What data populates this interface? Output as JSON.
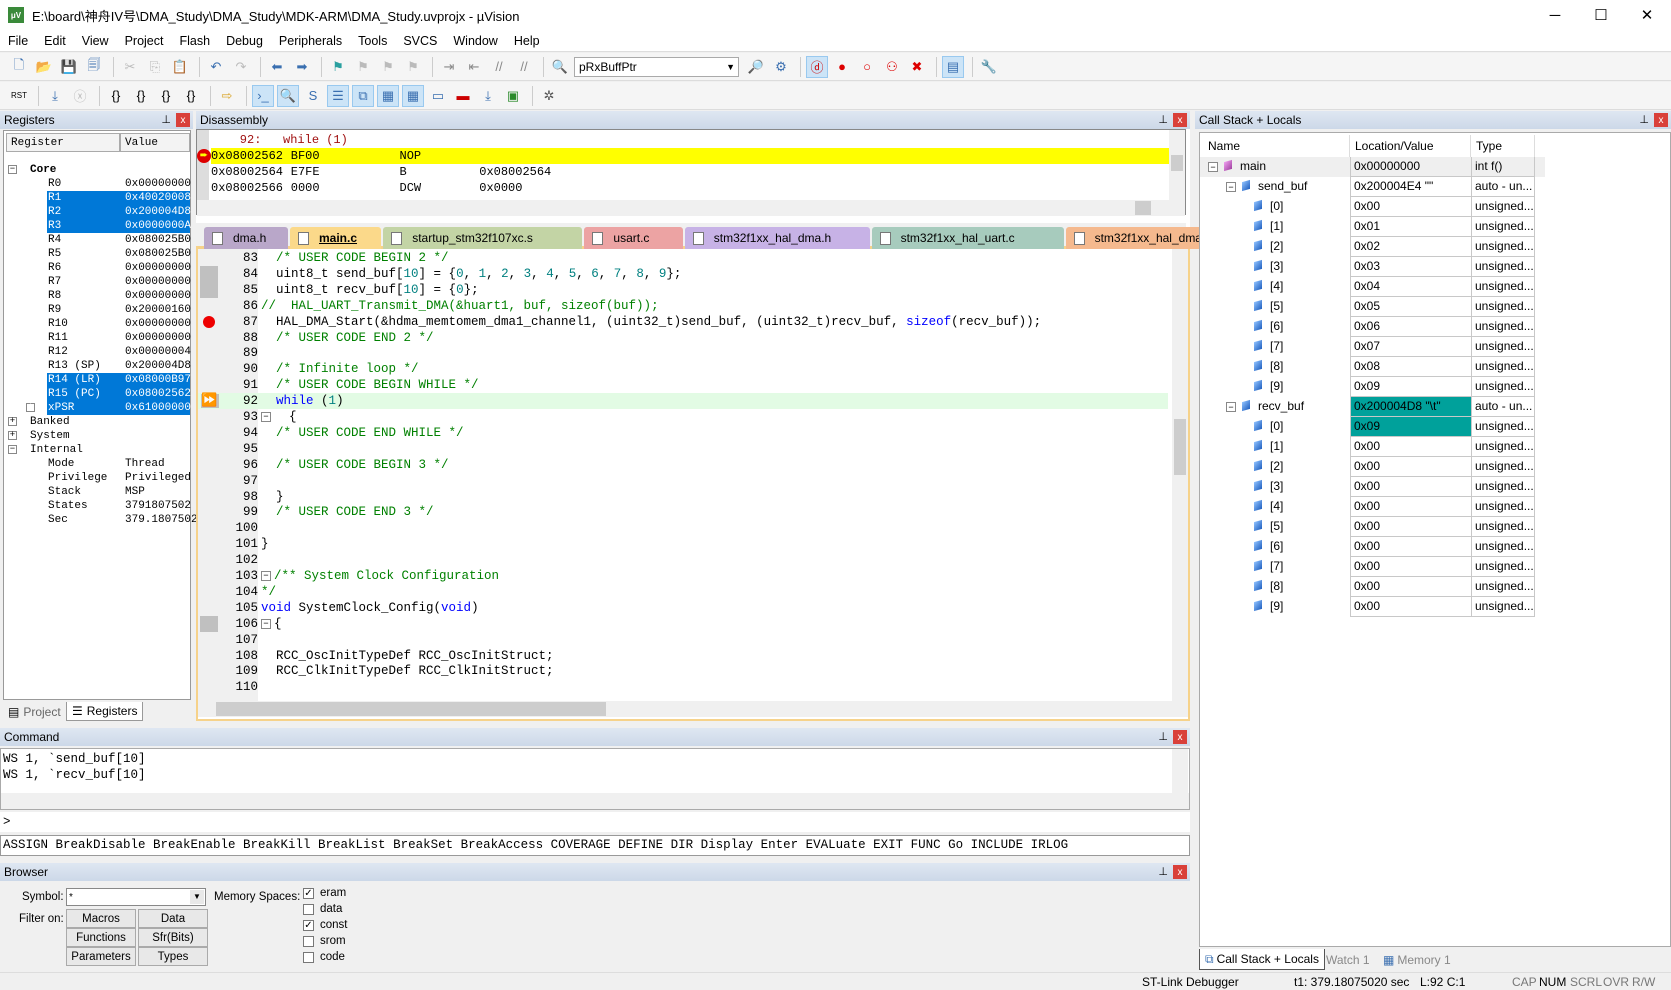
{
  "window": {
    "title": "E:\\board\\神舟IV号\\DMA_Study\\DMA_Study\\MDK-ARM\\DMA_Study.uvprojx - µVision",
    "app_icon_text": "μV",
    "minimize": "─",
    "maximize": "☐",
    "close": "✕"
  },
  "menu": [
    "File",
    "Edit",
    "View",
    "Project",
    "Flash",
    "Debug",
    "Peripherals",
    "Tools",
    "SVCS",
    "Window",
    "Help"
  ],
  "toolbar1": {
    "combo_value": "pRxBuffPtr"
  },
  "registers": {
    "title": "Registers",
    "col_register": "Register",
    "col_value": "Value",
    "rows": [
      {
        "name": "Core",
        "value": "",
        "level": 0,
        "expander": "−",
        "bold": true,
        "selected": false
      },
      {
        "name": "R0",
        "value": "0x00000000",
        "level": 1,
        "selected": false
      },
      {
        "name": "R1",
        "value": "0x40020008",
        "level": 1,
        "selected": true
      },
      {
        "name": "R2",
        "value": "0x200004D8",
        "level": 1,
        "selected": true
      },
      {
        "name": "R3",
        "value": "0x0000000A",
        "level": 1,
        "selected": true
      },
      {
        "name": "R4",
        "value": "0x080025B0",
        "level": 1,
        "selected": false
      },
      {
        "name": "R5",
        "value": "0x080025B0",
        "level": 1,
        "selected": false
      },
      {
        "name": "R6",
        "value": "0x00000000",
        "level": 1,
        "selected": false
      },
      {
        "name": "R7",
        "value": "0x00000000",
        "level": 1,
        "selected": false
      },
      {
        "name": "R8",
        "value": "0x00000000",
        "level": 1,
        "selected": false
      },
      {
        "name": "R9",
        "value": "0x20000160",
        "level": 1,
        "selected": false
      },
      {
        "name": "R10",
        "value": "0x00000000",
        "level": 1,
        "selected": false
      },
      {
        "name": "R11",
        "value": "0x00000000",
        "level": 1,
        "selected": false
      },
      {
        "name": "R12",
        "value": "0x00000004",
        "level": 1,
        "selected": false
      },
      {
        "name": "R13 (SP)",
        "value": "0x200004D8",
        "level": 1,
        "selected": false
      },
      {
        "name": "R14 (LR)",
        "value": "0x08000B97",
        "level": 1,
        "selected": true
      },
      {
        "name": "R15 (PC)",
        "value": "0x08002562",
        "level": 1,
        "selected": true
      },
      {
        "name": "xPSR",
        "value": "0x61000000",
        "level": 1,
        "expander": "+",
        "selected": true
      },
      {
        "name": "Banked",
        "value": "",
        "level": 0,
        "expander": "+",
        "selected": false
      },
      {
        "name": "System",
        "value": "",
        "level": 0,
        "expander": "+",
        "selected": false
      },
      {
        "name": "Internal",
        "value": "",
        "level": 0,
        "expander": "−",
        "selected": false
      },
      {
        "name": "Mode",
        "value": "Thread",
        "level": 1,
        "selected": false
      },
      {
        "name": "Privilege",
        "value": "Privileged",
        "level": 1,
        "selected": false
      },
      {
        "name": "Stack",
        "value": "MSP",
        "level": 1,
        "selected": false
      },
      {
        "name": "States",
        "value": "3791807502",
        "level": 1,
        "selected": false
      },
      {
        "name": "Sec",
        "value": "379.18075020",
        "level": 1,
        "selected": false
      }
    ],
    "tabs": [
      "Project",
      "Registers"
    ]
  },
  "disassembly": {
    "title": "Disassembly",
    "source_line": "    92:   while (1)",
    "rows": [
      {
        "addr": "0x08002562",
        "op": "BF00",
        "mn": "NOP",
        "arg": "",
        "current": true
      },
      {
        "addr": "0x08002564",
        "op": "E7FE",
        "mn": "B",
        "arg": "0x08002564",
        "current": false
      },
      {
        "addr": "0x08002566",
        "op": "0000",
        "mn": "DCW",
        "arg": "0x0000",
        "current": false
      }
    ]
  },
  "file_tabs": [
    {
      "label": "dma.h",
      "color": "#b9a7c9",
      "active": false
    },
    {
      "label": "main.c",
      "color": "#fbd98a",
      "active": true
    },
    {
      "label": "startup_stm32f107xc.s",
      "color": "#c3d4a5",
      "active": false
    },
    {
      "label": "usart.c",
      "color": "#eca3a3",
      "active": false
    },
    {
      "label": "stm32f1xx_hal_dma.h",
      "color": "#c7b2e6",
      "active": false
    },
    {
      "label": "stm32f1xx_hal_uart.c",
      "color": "#a7cbbd",
      "active": false
    },
    {
      "label": "stm32f1xx_hal_dma.c",
      "color": "#f5b98e",
      "active": false
    }
  ],
  "code": [
    {
      "n": "83",
      "t": [
        [
          "  /* USER CODE BEGIN 2 */",
          "c"
        ]
      ]
    },
    {
      "n": "84",
      "g": "gray",
      "t": [
        [
          "  uint8_t send_buf[",
          "t"
        ],
        [
          "10",
          "n"
        ],
        [
          "] = {",
          "t"
        ],
        [
          "0",
          "n"
        ],
        [
          ", ",
          "t"
        ],
        [
          "1",
          "n"
        ],
        [
          ", ",
          "t"
        ],
        [
          "2",
          "n"
        ],
        [
          ", ",
          "t"
        ],
        [
          "3",
          "n"
        ],
        [
          ", ",
          "t"
        ],
        [
          "4",
          "n"
        ],
        [
          ", ",
          "t"
        ],
        [
          "5",
          "n"
        ],
        [
          ", ",
          "t"
        ],
        [
          "6",
          "n"
        ],
        [
          ", ",
          "t"
        ],
        [
          "7",
          "n"
        ],
        [
          ", ",
          "t"
        ],
        [
          "8",
          "n"
        ],
        [
          ", ",
          "t"
        ],
        [
          "9",
          "n"
        ],
        [
          "};",
          "t"
        ]
      ]
    },
    {
      "n": "85",
      "g": "gray",
      "t": [
        [
          "  uint8_t recv_buf[",
          "t"
        ],
        [
          "10",
          "n"
        ],
        [
          "] = {",
          "t"
        ],
        [
          "0",
          "n"
        ],
        [
          "};",
          "t"
        ]
      ]
    },
    {
      "n": "86",
      "t": [
        [
          "//  HAL_UART_Transmit_DMA(&huart1, buf, sizeof(buf));",
          "c"
        ]
      ]
    },
    {
      "n": "87",
      "g": "breakpoint",
      "t": [
        [
          "  HAL_DMA_Start(&hdma_memtomem_dma1_channel1, (uint32_t)send_buf, (uint32_t)recv_buf, ",
          "t"
        ],
        [
          "sizeof",
          "k"
        ],
        [
          "(recv_buf));",
          "t"
        ]
      ]
    },
    {
      "n": "88",
      "t": [
        [
          "  /* USER CODE END 2 */",
          "c"
        ]
      ]
    },
    {
      "n": "89",
      "t": []
    },
    {
      "n": "90",
      "t": [
        [
          "  /* Infinite loop */",
          "c"
        ]
      ]
    },
    {
      "n": "91",
      "t": [
        [
          "  /* USER CODE BEGIN WHILE */",
          "c"
        ]
      ]
    },
    {
      "n": "92",
      "g": "current",
      "hl": true,
      "t": [
        [
          "  ",
          "t"
        ],
        [
          "while",
          "k"
        ],
        [
          " (",
          "t"
        ],
        [
          "1",
          "n"
        ],
        [
          ")",
          "t"
        ]
      ]
    },
    {
      "n": "93",
      "fold": "−",
      "t": [
        [
          "  {",
          "t"
        ]
      ]
    },
    {
      "n": "94",
      "t": [
        [
          "  /* USER CODE END WHILE */",
          "c"
        ]
      ]
    },
    {
      "n": "95",
      "t": []
    },
    {
      "n": "96",
      "t": [
        [
          "  /* USER CODE BEGIN 3 */",
          "c"
        ]
      ]
    },
    {
      "n": "97",
      "t": []
    },
    {
      "n": "98",
      "t": [
        [
          "  }",
          "t"
        ]
      ]
    },
    {
      "n": "99",
      "t": [
        [
          "  /* USER CODE END 3 */",
          "c"
        ]
      ]
    },
    {
      "n": "100",
      "t": []
    },
    {
      "n": "101",
      "t": [
        [
          "}",
          "t"
        ]
      ]
    },
    {
      "n": "102",
      "t": []
    },
    {
      "n": "103",
      "fold": "−",
      "t": [
        [
          "/** System Clock Configuration",
          "c"
        ]
      ]
    },
    {
      "n": "104",
      "t": [
        [
          "*/",
          "c"
        ]
      ]
    },
    {
      "n": "105",
      "t": [
        [
          "void",
          "k"
        ],
        [
          " SystemClock_Config(",
          "t"
        ],
        [
          "void",
          "k"
        ],
        [
          ")",
          "t"
        ]
      ]
    },
    {
      "n": "106",
      "g": "gray",
      "fold": "−",
      "t": [
        [
          "{",
          "t"
        ]
      ]
    },
    {
      "n": "107",
      "t": []
    },
    {
      "n": "108",
      "t": [
        [
          "  RCC_OscInitTypeDef RCC_OscInitStruct;",
          "t"
        ]
      ]
    },
    {
      "n": "109",
      "t": [
        [
          "  RCC_ClkInitTypeDef RCC_ClkInitStruct;",
          "t"
        ]
      ]
    },
    {
      "n": "110",
      "t": []
    }
  ],
  "command": {
    "title": "Command",
    "lines": [
      "WS 1, `send_buf[10]",
      "WS 1, `recv_buf[10]"
    ],
    "prompt": ">",
    "hints": "ASSIGN BreakDisable BreakEnable BreakKill BreakList BreakSet BreakAccess COVERAGE DEFINE DIR Display Enter EVALuate EXIT FUNC Go INCLUDE IRLOG"
  },
  "browser": {
    "title": "Browser",
    "symbol_label": "Symbol:",
    "symbol_value": "*",
    "filter_label": "Filter on:",
    "filters": [
      "Macros",
      "Data",
      "Functions",
      "Sfr(Bits)",
      "Parameters",
      "Types"
    ],
    "memory_label": "Memory Spaces:",
    "spaces": [
      {
        "label": "eram",
        "checked": true
      },
      {
        "label": "data",
        "checked": false
      },
      {
        "label": "const",
        "checked": true
      },
      {
        "label": "srom",
        "checked": false
      },
      {
        "label": "code",
        "checked": false
      }
    ]
  },
  "callstack": {
    "title": "Call Stack + Locals",
    "col_name": "Name",
    "col_value": "Location/Value",
    "col_type": "Type",
    "rows": [
      {
        "name": "main",
        "value": "0x00000000",
        "type": "int f()",
        "level": 0,
        "exp": "−",
        "kind": "main"
      },
      {
        "name": "send_buf",
        "value": "0x200004E4 \"\"",
        "type": "auto - un...",
        "level": 1,
        "exp": "−"
      },
      {
        "name": "[0]",
        "value": "0x00",
        "type": "unsigned...",
        "level": 2
      },
      {
        "name": "[1]",
        "value": "0x01",
        "type": "unsigned...",
        "level": 2
      },
      {
        "name": "[2]",
        "value": "0x02",
        "type": "unsigned...",
        "level": 2
      },
      {
        "name": "[3]",
        "value": "0x03",
        "type": "unsigned...",
        "level": 2
      },
      {
        "name": "[4]",
        "value": "0x04",
        "type": "unsigned...",
        "level": 2
      },
      {
        "name": "[5]",
        "value": "0x05",
        "type": "unsigned...",
        "level": 2
      },
      {
        "name": "[6]",
        "value": "0x06",
        "type": "unsigned...",
        "level": 2
      },
      {
        "name": "[7]",
        "value": "0x07",
        "type": "unsigned...",
        "level": 2
      },
      {
        "name": "[8]",
        "value": "0x08",
        "type": "unsigned...",
        "level": 2
      },
      {
        "name": "[9]",
        "value": "0x09",
        "type": "unsigned...",
        "level": 2
      },
      {
        "name": "recv_buf",
        "value": "0x200004D8 \"\\t\"",
        "type": "auto - un...",
        "level": 1,
        "exp": "−",
        "changed": true
      },
      {
        "name": "[0]",
        "value": "0x09",
        "type": "unsigned...",
        "level": 2,
        "changed": true
      },
      {
        "name": "[1]",
        "value": "0x00",
        "type": "unsigned...",
        "level": 2
      },
      {
        "name": "[2]",
        "value": "0x00",
        "type": "unsigned...",
        "level": 2
      },
      {
        "name": "[3]",
        "value": "0x00",
        "type": "unsigned...",
        "level": 2
      },
      {
        "name": "[4]",
        "value": "0x00",
        "type": "unsigned...",
        "level": 2
      },
      {
        "name": "[5]",
        "value": "0x00",
        "type": "unsigned...",
        "level": 2
      },
      {
        "name": "[6]",
        "value": "0x00",
        "type": "unsigned...",
        "level": 2
      },
      {
        "name": "[7]",
        "value": "0x00",
        "type": "unsigned...",
        "level": 2
      },
      {
        "name": "[8]",
        "value": "0x00",
        "type": "unsigned...",
        "level": 2
      },
      {
        "name": "[9]",
        "value": "0x00",
        "type": "unsigned...",
        "level": 2
      }
    ],
    "tabs": [
      "Call Stack + Locals",
      "Watch 1",
      "Memory 1"
    ]
  },
  "status": {
    "debugger": "ST-Link Debugger",
    "time": "t1: 379.18075020 sec",
    "position": "L:92 C:1",
    "indicators": [
      "CAP",
      "NUM",
      "SCRL",
      "OVR",
      "R/W"
    ]
  },
  "colors": {
    "current_line": "#ffff00",
    "changed_value": "#00a19b",
    "selection": "#0078d7",
    "editor_border": "#f6d28a"
  }
}
